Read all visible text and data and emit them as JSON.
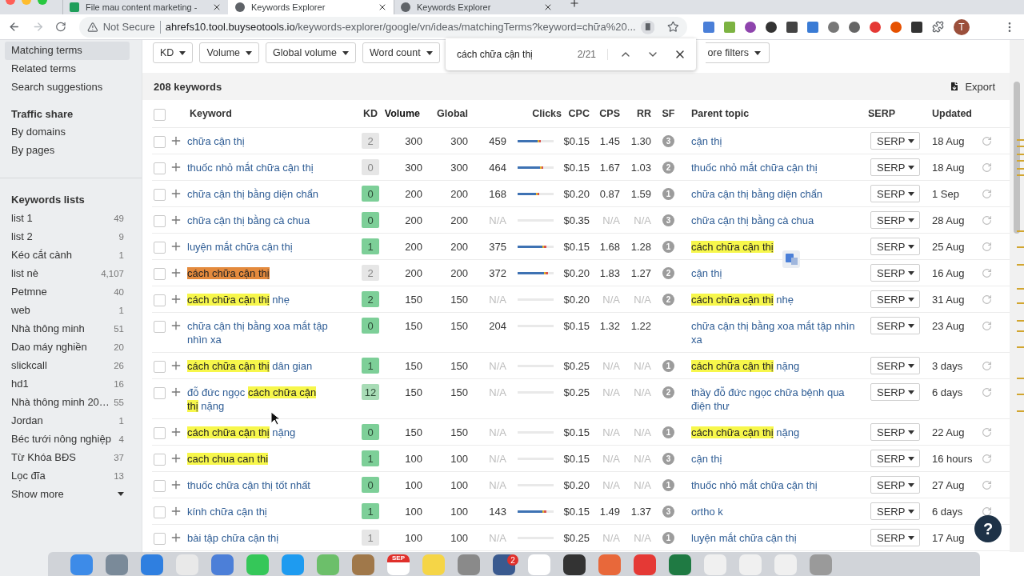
{
  "browser": {
    "tabs": [
      {
        "title": "File mau content marketing -",
        "selected": false,
        "kind": "sheet"
      },
      {
        "title": "Keywords Explorer",
        "selected": true,
        "kind": "web"
      },
      {
        "title": "Keywords Explorer",
        "selected": false,
        "kind": "web"
      }
    ],
    "security": "Not Secure",
    "url_host": "ahrefs10.tool.buyseotools.io",
    "url_path": "/keywords-explorer/google/vn/ideas/matchingTerms?keyword=chữa%20...",
    "profile_initial": "T"
  },
  "sidebar": {
    "nav": [
      {
        "label": "Matching terms",
        "selected": true
      },
      {
        "label": "Related terms",
        "selected": false
      },
      {
        "label": "Search suggestions",
        "selected": false
      }
    ],
    "traffic_share": {
      "title": "Traffic share",
      "items": [
        "By domains",
        "By pages"
      ]
    },
    "keyword_lists": {
      "title": "Keywords lists",
      "items": [
        {
          "name": "list 1",
          "count": "49"
        },
        {
          "name": "list 2",
          "count": "9"
        },
        {
          "name": "Kéo cắt cành",
          "count": "1"
        },
        {
          "name": "list nè",
          "count": "4,107"
        },
        {
          "name": "Petmne",
          "count": "40"
        },
        {
          "name": "web",
          "count": "1"
        },
        {
          "name": "Nhà thông minh",
          "count": "51"
        },
        {
          "name": "Dao máy nghiền",
          "count": "20"
        },
        {
          "name": "slickcall",
          "count": "26"
        },
        {
          "name": "hd1",
          "count": "16"
        },
        {
          "name": "Nhà thông minh 20…",
          "count": "55"
        },
        {
          "name": "Jordan",
          "count": "1"
        },
        {
          "name": "Béc tưới nông nghiệp",
          "count": "4"
        },
        {
          "name": "Từ Khóa BĐS",
          "count": "37"
        },
        {
          "name": "Lọc đĩa",
          "count": "13"
        }
      ],
      "show_more": "Show more"
    }
  },
  "filters": {
    "items": [
      "KD",
      "Volume",
      "Global volume",
      "Word count"
    ],
    "more": "ore filters"
  },
  "find_bar": {
    "value": "cách chữa cận thị",
    "count": "2/21"
  },
  "results": {
    "count": "208 keywords",
    "export": "Export"
  },
  "table": {
    "select_all": {
      "checked": false
    },
    "columns": [
      {
        "label": "Keyword",
        "sorted": false
      },
      {
        "label": "KD",
        "sorted": false
      },
      {
        "label": "Volume",
        "sorted": true
      },
      {
        "label": "Global",
        "sorted": false
      },
      {
        "label": "Clicks",
        "sorted": false
      },
      {
        "label": "CPC",
        "sorted": false
      },
      {
        "label": "CPS",
        "sorted": false
      },
      {
        "label": "RR",
        "sorted": false
      },
      {
        "label": "SF",
        "sorted": false
      },
      {
        "label": "Parent topic",
        "sorted": false
      },
      {
        "label": "SERP",
        "sorted": false
      },
      {
        "label": "Updated",
        "sorted": false
      }
    ],
    "rows": [
      {
        "checked": false,
        "keyword": [
          {
            "text": "chữa cận thị",
            "kind": "plain"
          }
        ],
        "kd": {
          "value": "2",
          "color": "#e6e6e6"
        },
        "volume": "300",
        "global": "300",
        "clicks": {
          "text": "459",
          "muted": false
        },
        "clicks_bar": {
          "level": 0.65
        },
        "cpc": "$0.15",
        "cps": {
          "text": "1.45",
          "muted": false
        },
        "rr": {
          "text": "1.30",
          "muted": false
        },
        "sf": "3",
        "parent_topic": [
          {
            "text": "cận thị",
            "kind": "plain"
          }
        ],
        "serp": "SERP",
        "updated": "18 Aug"
      },
      {
        "checked": false,
        "keyword": [
          {
            "text": "thuốc nhỏ mắt chữa cận thị",
            "kind": "plain"
          }
        ],
        "kd": {
          "value": "0",
          "color": "#e6e6e6"
        },
        "volume": "300",
        "global": "300",
        "clicks": {
          "text": "464",
          "muted": false
        },
        "clicks_bar": {
          "level": 0.7
        },
        "cpc": "$0.15",
        "cps": {
          "text": "1.67",
          "muted": false
        },
        "rr": {
          "text": "1.03",
          "muted": false
        },
        "sf": "2",
        "parent_topic": [
          {
            "text": "thuốc nhỏ mắt chữa cận thị",
            "kind": "plain"
          }
        ],
        "serp": "SERP",
        "updated": "18 Aug"
      },
      {
        "checked": false,
        "keyword": [
          {
            "text": "chữa cận thị bằng diện chẩn",
            "kind": "plain"
          }
        ],
        "kd": {
          "value": "0",
          "color": "#7dcf98"
        },
        "volume": "200",
        "global": "200",
        "clicks": {
          "text": "168",
          "muted": false
        },
        "clicks_bar": {
          "level": 0.6
        },
        "cpc": "$0.20",
        "cps": {
          "text": "0.87",
          "muted": false
        },
        "rr": {
          "text": "1.59",
          "muted": false
        },
        "sf": "1",
        "parent_topic": [
          {
            "text": "chữa cận thị bằng diện chẩn",
            "kind": "plain"
          }
        ],
        "serp": "SERP",
        "updated": "1 Sep"
      },
      {
        "checked": false,
        "keyword": [
          {
            "text": "chữa cận thị bằng cà chua",
            "kind": "plain"
          }
        ],
        "kd": {
          "value": "0",
          "color": "#7dcf98"
        },
        "volume": "200",
        "global": "200",
        "clicks": {
          "text": "N/A",
          "muted": true
        },
        "clicks_bar": {
          "level": 0
        },
        "cpc": "$0.35",
        "cps": {
          "text": "N/A",
          "muted": true
        },
        "rr": {
          "text": "N/A",
          "muted": true
        },
        "sf": "3",
        "parent_topic": [
          {
            "text": "chữa cận thị bằng cà chua",
            "kind": "plain"
          }
        ],
        "serp": "SERP",
        "updated": "28 Aug"
      },
      {
        "checked": false,
        "keyword": [
          {
            "text": "luyện mắt chữa cận thị",
            "kind": "plain"
          }
        ],
        "kd": {
          "value": "1",
          "color": "#7dcf98"
        },
        "volume": "200",
        "global": "200",
        "clicks": {
          "text": "375",
          "muted": false
        },
        "clicks_bar": {
          "level": 0.8
        },
        "cpc": "$0.15",
        "cps": {
          "text": "1.68",
          "muted": false
        },
        "rr": {
          "text": "1.28",
          "muted": false
        },
        "sf": "1",
        "parent_topic": [
          {
            "text": "cách chữa cận thị",
            "kind": "match"
          }
        ],
        "serp": "SERP",
        "updated": "25 Aug"
      },
      {
        "checked": false,
        "keyword": [
          {
            "text": "cách chữa cận thị",
            "kind": "current"
          }
        ],
        "kd": {
          "value": "2",
          "color": "#e6e6e6"
        },
        "volume": "200",
        "global": "200",
        "clicks": {
          "text": "372",
          "muted": false
        },
        "clicks_bar": {
          "level": 0.84
        },
        "cpc": "$0.20",
        "cps": {
          "text": "1.83",
          "muted": false
        },
        "rr": {
          "text": "1.27",
          "muted": false
        },
        "sf": "2",
        "parent_topic": [
          {
            "text": "cận thị",
            "kind": "plain"
          }
        ],
        "serp": "SERP",
        "updated": "16 Aug"
      },
      {
        "checked": false,
        "keyword": [
          {
            "text": "cách chữa cận thị",
            "kind": "match"
          },
          {
            "text": "nhẹ",
            "kind": "plain"
          }
        ],
        "kd": {
          "value": "2",
          "color": "#7dcf98"
        },
        "volume": "150",
        "global": "150",
        "clicks": {
          "text": "N/A",
          "muted": true
        },
        "clicks_bar": {
          "level": 0
        },
        "cpc": "$0.20",
        "cps": {
          "text": "N/A",
          "muted": true
        },
        "rr": {
          "text": "N/A",
          "muted": true
        },
        "sf": "2",
        "parent_topic": [
          {
            "text": "cách chữa cận thị",
            "kind": "match"
          },
          {
            "text": "nhẹ",
            "kind": "plain"
          }
        ],
        "serp": "SERP",
        "updated": "31 Aug"
      },
      {
        "checked": false,
        "keyword": [
          {
            "text": "chữa cận thị bằng xoa mắt tập nhìn xa",
            "kind": "plain"
          }
        ],
        "kd": {
          "value": "0",
          "color": "#7dcf98"
        },
        "volume": "150",
        "global": "150",
        "clicks": {
          "text": "204",
          "muted": false
        },
        "clicks_bar": {
          "level": 0
        },
        "cpc": "$0.15",
        "cps": {
          "text": "1.32",
          "muted": false
        },
        "rr": {
          "text": "1.22",
          "muted": false
        },
        "parent_topic": [
          {
            "text": "chữa cận thị bằng xoa mắt tập nhìn xa",
            "kind": "plain"
          }
        ],
        "serp": "SERP",
        "updated": "23 Aug"
      },
      {
        "checked": false,
        "keyword": [
          {
            "text": "cách chữa cận thị",
            "kind": "match"
          },
          {
            "text": "dân gian",
            "kind": "plain"
          }
        ],
        "kd": {
          "value": "1",
          "color": "#7dcf98"
        },
        "volume": "150",
        "global": "150",
        "clicks": {
          "text": "N/A",
          "muted": true
        },
        "clicks_bar": {
          "level": 0
        },
        "cpc": "$0.25",
        "cps": {
          "text": "N/A",
          "muted": true
        },
        "rr": {
          "text": "N/A",
          "muted": true
        },
        "sf": "1",
        "parent_topic": [
          {
            "text": "cách chữa cận thị",
            "kind": "match"
          },
          {
            "text": "nặng",
            "kind": "plain"
          }
        ],
        "serp": "SERP",
        "updated": "3 days"
      },
      {
        "checked": false,
        "keyword": [
          {
            "text": "đỗ đức ngọc",
            "kind": "plain"
          },
          {
            "text": "cách chữa cận thị",
            "kind": "match"
          },
          {
            "text": "nặng",
            "kind": "plain"
          }
        ],
        "kd": {
          "value": "12",
          "color": "#a8dcb6"
        },
        "volume": "150",
        "global": "150",
        "clicks": {
          "text": "N/A",
          "muted": true
        },
        "clicks_bar": {
          "level": 0
        },
        "cpc": "$0.25",
        "cps": {
          "text": "N/A",
          "muted": true
        },
        "rr": {
          "text": "N/A",
          "muted": true
        },
        "sf": "2",
        "parent_topic": [
          {
            "text": "thầy đỗ đức ngọc chữa bệnh qua điện thư",
            "kind": "plain"
          }
        ],
        "serp": "SERP",
        "updated": "6 days"
      },
      {
        "checked": false,
        "keyword": [
          {
            "text": "cách chữa cận thị",
            "kind": "match"
          },
          {
            "text": "nặng",
            "kind": "plain"
          }
        ],
        "kd": {
          "value": "0",
          "color": "#7dcf98"
        },
        "volume": "150",
        "global": "150",
        "clicks": {
          "text": "N/A",
          "muted": true
        },
        "clicks_bar": {
          "level": 0
        },
        "cpc": "$0.15",
        "cps": {
          "text": "N/A",
          "muted": true
        },
        "rr": {
          "text": "N/A",
          "muted": true
        },
        "sf": "1",
        "parent_topic": [
          {
            "text": "cách chữa cận thị",
            "kind": "match"
          },
          {
            "text": "nặng",
            "kind": "plain"
          }
        ],
        "serp": "SERP",
        "updated": "22 Aug"
      },
      {
        "checked": false,
        "keyword": [
          {
            "text": "cach chua can thi",
            "kind": "match"
          }
        ],
        "kd": {
          "value": "1",
          "color": "#7dcf98"
        },
        "volume": "100",
        "global": "100",
        "clicks": {
          "text": "N/A",
          "muted": true
        },
        "clicks_bar": {
          "level": 0
        },
        "cpc": "$0.15",
        "cps": {
          "text": "N/A",
          "muted": true
        },
        "rr": {
          "text": "N/A",
          "muted": true
        },
        "sf": "3",
        "parent_topic": [
          {
            "text": "cận thị",
            "kind": "plain"
          }
        ],
        "serp": "SERP",
        "updated": "16 hours"
      },
      {
        "checked": false,
        "keyword": [
          {
            "text": "thuốc chữa cận thị tốt nhất",
            "kind": "plain"
          }
        ],
        "kd": {
          "value": "0",
          "color": "#7dcf98"
        },
        "volume": "100",
        "global": "100",
        "clicks": {
          "text": "N/A",
          "muted": true
        },
        "clicks_bar": {
          "level": 0
        },
        "cpc": "$0.20",
        "cps": {
          "text": "N/A",
          "muted": true
        },
        "rr": {
          "text": "N/A",
          "muted": true
        },
        "sf": "1",
        "parent_topic": [
          {
            "text": "thuốc nhỏ mắt chữa cận thị",
            "kind": "plain"
          }
        ],
        "serp": "SERP",
        "updated": "27 Aug"
      },
      {
        "checked": false,
        "keyword": [
          {
            "text": "kính chữa cận thị",
            "kind": "plain"
          }
        ],
        "kd": {
          "value": "1",
          "color": "#7dcf98"
        },
        "volume": "100",
        "global": "100",
        "clicks": {
          "text": "143",
          "muted": false
        },
        "clicks_bar": {
          "level": 0.8
        },
        "cpc": "$0.15",
        "cps": {
          "text": "1.49",
          "muted": false
        },
        "rr": {
          "text": "1.37",
          "muted": false
        },
        "sf": "3",
        "parent_topic": [
          {
            "text": "ortho k",
            "kind": "plain"
          }
        ],
        "serp": "SERP",
        "updated": "6 days"
      },
      {
        "checked": false,
        "keyword": [
          {
            "text": "bài tập chữa cận thị",
            "kind": "plain"
          }
        ],
        "kd": {
          "value": "1",
          "color": "#e6e6e6"
        },
        "volume": "100",
        "global": "100",
        "clicks": {
          "text": "N/A",
          "muted": true
        },
        "clicks_bar": {
          "level": 0
        },
        "cpc": "$0.25",
        "cps": {
          "text": "N/A",
          "muted": true
        },
        "rr": {
          "text": "N/A",
          "muted": true
        },
        "sf": "1",
        "parent_topic": [
          {
            "text": "luyện mắt chữa cận thị",
            "kind": "plain"
          }
        ],
        "serp": "SERP",
        "updated": "17 Aug"
      }
    ]
  },
  "help": "?",
  "dock": {
    "badge": "2",
    "calendar_month": "SEP"
  }
}
